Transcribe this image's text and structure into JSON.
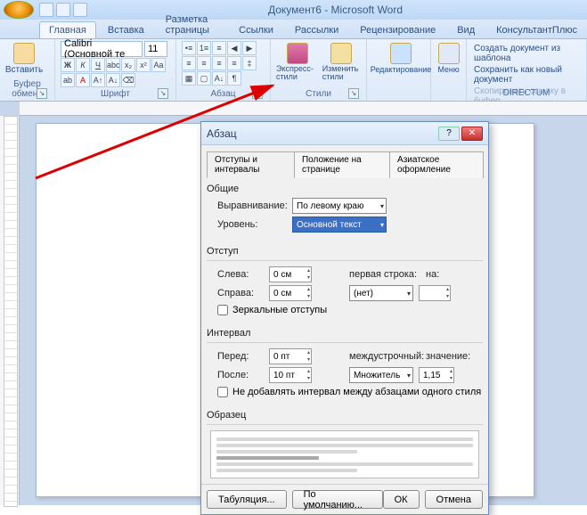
{
  "window": {
    "title": "Документ6 - Microsoft Word"
  },
  "tabs": {
    "items": [
      "Главная",
      "Вставка",
      "Разметка страницы",
      "Ссылки",
      "Рассылки",
      "Рецензирование",
      "Вид",
      "КонсультантПлюс"
    ],
    "active": 0
  },
  "ribbon": {
    "clipboard": {
      "label": "Буфер обмена",
      "paste": "Вставить"
    },
    "font": {
      "label": "Шрифт",
      "name": "Calibri (Основной те",
      "size": "11"
    },
    "paragraph": {
      "label": "Абзац"
    },
    "styles": {
      "label": "Стили",
      "quick": "Экспресс-стили",
      "change": "Изменить стили"
    },
    "editing": {
      "label": "Редактирование"
    },
    "menu": {
      "label": "Меню"
    },
    "directum": {
      "label": "DIRECTUM",
      "item1": "Создать документ из шаблона",
      "item2": "Сохранить как новый документ",
      "item3": "Скопировать ссылку в буфер"
    }
  },
  "dialog": {
    "title": "Абзац",
    "tabs": {
      "t1": "Отступы и интервалы",
      "t2": "Положение на странице",
      "t3": "Азиатское оформление"
    },
    "general": {
      "label": "Общие",
      "align_label": "Выравнивание:",
      "align_value": "По левому краю",
      "level_label": "Уровень:",
      "level_value": "Основной текст"
    },
    "indent": {
      "label": "Отступ",
      "left_label": "Слева:",
      "left_value": "0 см",
      "right_label": "Справа:",
      "right_value": "0 см",
      "firstline_label": "первая строка:",
      "firstline_value": "(нет)",
      "by_label": "на:",
      "by_value": "",
      "mirror": "Зеркальные отступы"
    },
    "spacing": {
      "label": "Интервал",
      "before_label": "Перед:",
      "before_value": "0 пт",
      "after_label": "После:",
      "after_value": "10 пт",
      "line_label": "междустрочный:",
      "line_value": "Множитель",
      "at_label": "значение:",
      "at_value": "1,15",
      "nosame": "Не добавлять интервал между абзацами одного стиля"
    },
    "preview_label": "Образец",
    "buttons": {
      "tabs": "Табуляция...",
      "default": "По умолчанию...",
      "ok": "ОК",
      "cancel": "Отмена"
    }
  }
}
